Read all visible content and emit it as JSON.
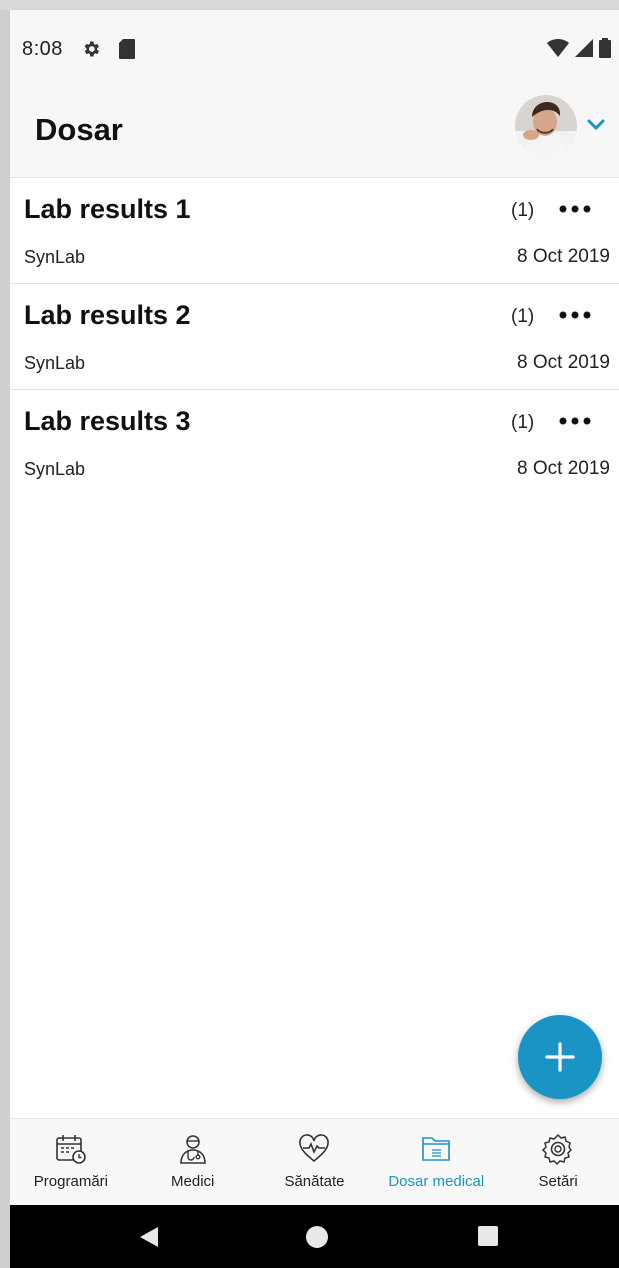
{
  "status_bar": {
    "time": "8:08",
    "icons": [
      "gear-icon",
      "sd-card-icon",
      "wifi-icon",
      "signal-icon",
      "battery-icon"
    ]
  },
  "app_bar": {
    "title": "Dosar",
    "avatar_icon": "user-avatar",
    "dropdown_icon": "chevron-down-icon"
  },
  "records": [
    {
      "title": "Lab results 1",
      "count": "(1)",
      "lab": "SynLab",
      "date": "8 Oct 2019"
    },
    {
      "title": "Lab results 2",
      "count": "(1)",
      "lab": "SynLab",
      "date": "8 Oct 2019"
    },
    {
      "title": "Lab results 3",
      "count": "(1)",
      "lab": "SynLab",
      "date": "8 Oct 2019"
    }
  ],
  "fab": {
    "icon": "plus-icon"
  },
  "bottom_nav": [
    {
      "label": "Programări",
      "icon": "calendar-icon",
      "active": false
    },
    {
      "label": "Medici",
      "icon": "doctor-icon",
      "active": false
    },
    {
      "label": "Sănătate",
      "icon": "heartbeat-icon",
      "active": false
    },
    {
      "label": "Dosar medical",
      "icon": "folder-icon",
      "active": true
    },
    {
      "label": "Setări",
      "icon": "settings-icon",
      "active": false
    }
  ],
  "system_nav": [
    "back-icon",
    "home-icon",
    "recents-icon"
  ],
  "colors": {
    "accent": "#1a94c5",
    "app_bar_bg": "#f7f7f7",
    "text": "#111111"
  }
}
